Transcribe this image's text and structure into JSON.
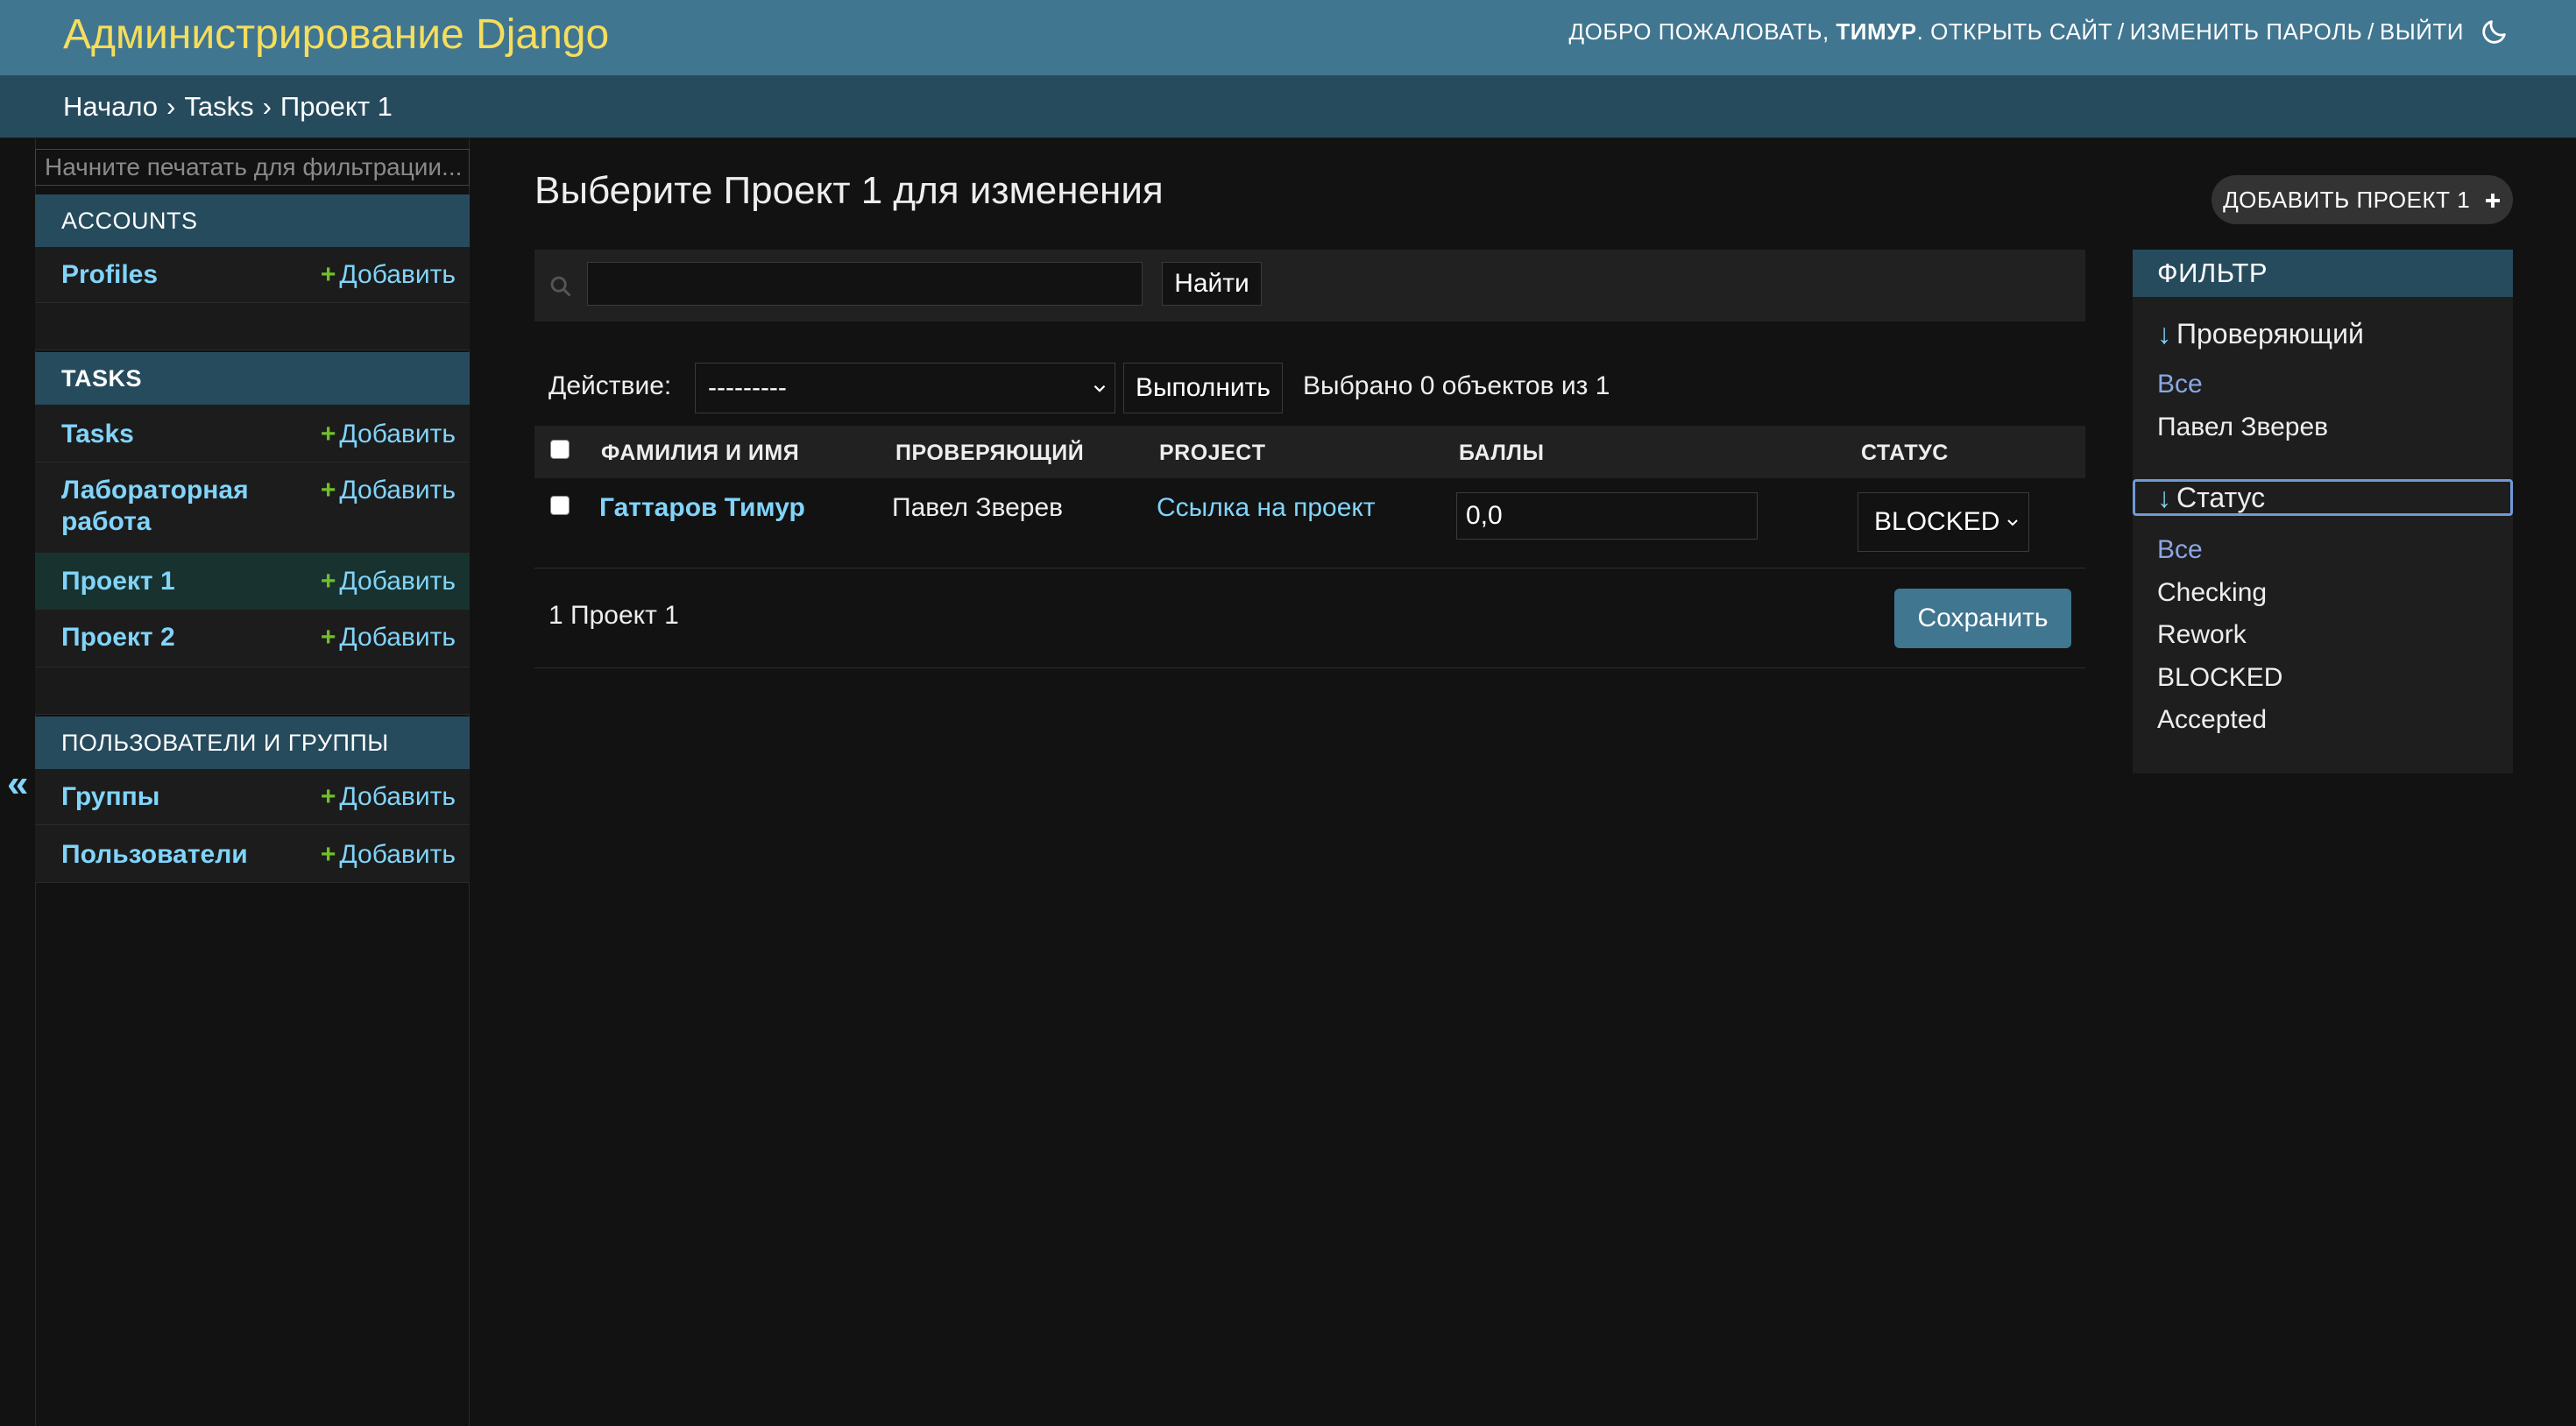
{
  "header": {
    "site_name": "Администрирование Django",
    "welcome": "ДОБРО ПОЖАЛОВАТЬ,",
    "username": "ТИМУР",
    "view_site": "ОТКРЫТЬ САЙТ",
    "change_password": "ИЗМЕНИТЬ ПАРОЛЬ",
    "logout": "ВЫЙТИ",
    "separator": "/"
  },
  "breadcrumbs": {
    "home": "Начало",
    "app": "Tasks",
    "current": "Проект 1",
    "separator": "›"
  },
  "sidebar": {
    "filter_placeholder": "Начните печатать для фильтрации...",
    "add_label": "Добавить",
    "toggle_label": "«",
    "modules": [
      {
        "caption": "ACCOUNTS",
        "items": [
          {
            "name": "Profiles"
          }
        ]
      },
      {
        "caption": "TASKS",
        "items": [
          {
            "name": "Tasks"
          },
          {
            "name": "Лабораторная работа"
          },
          {
            "name": "Проект 1",
            "current": true
          },
          {
            "name": "Проект 2"
          }
        ]
      },
      {
        "caption": "ПОЛЬЗОВАТЕЛИ И ГРУППЫ",
        "items": [
          {
            "name": "Группы"
          },
          {
            "name": "Пользователи"
          }
        ]
      }
    ]
  },
  "main": {
    "title": "Выберите Проект 1 для изменения",
    "add_button": "ДОБАВИТЬ ПРОЕКТ 1",
    "search_button": "Найти",
    "search_value": "",
    "action_label": "Действие:",
    "action_selected": "---------",
    "action_go": "Выполнить",
    "action_counter": "Выбрано 0 объектов из 1",
    "columns": [
      "ФАМИЛИЯ И ИМЯ",
      "ПРОВЕРЯЮЩИЙ",
      "PROJECT",
      "БАЛЛЫ",
      "СТАТУС"
    ],
    "rows": [
      {
        "name": "Гаттаров Тимур",
        "reviewer": "Павел Зверев",
        "project": "Ссылка на проект",
        "score": "0,0",
        "status": "BLOCKED"
      }
    ],
    "paginator": "1 Проект 1",
    "save_button": "Сохранить"
  },
  "filter": {
    "title": "ФИЛЬТР",
    "arrow": "↓",
    "groups": [
      {
        "title": "Проверяющий",
        "options": [
          "Все",
          "Павел Зверев"
        ],
        "selected": "Все"
      },
      {
        "title": "Статус",
        "options": [
          "Все",
          "Checking",
          "Rework",
          "BLOCKED",
          "Accepted"
        ],
        "selected": "Все"
      }
    ]
  },
  "colors": {
    "header_bg": "#417690",
    "branding": "#f5dd5d",
    "module_caption_bg": "#264b5d",
    "link": "#81d4fa",
    "add_plus": "#70bf2b",
    "page_bg": "#121212"
  }
}
